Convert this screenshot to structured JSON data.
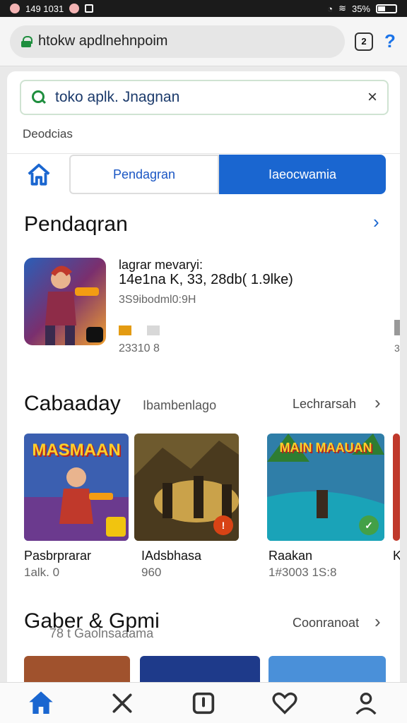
{
  "status_bar": {
    "time": "149 1031",
    "battery": "35%"
  },
  "browser": {
    "url": "htokw apdlnehnpoim",
    "tabs_label": "2",
    "menu_glyph": "?"
  },
  "search": {
    "query": "toko aplk. Jnagnan",
    "clear_glyph": "×"
  },
  "subtitle": "Deodcias",
  "segments": [
    {
      "label": "Pendagran",
      "active": false
    },
    {
      "label": "Iaeocwamia",
      "active": true
    }
  ],
  "section1": {
    "title": "Pendaqran",
    "featured": {
      "line1": "lagrar mevaryi:",
      "line2": "14e1na K, 33, 28db( 1.9lke)",
      "line3": "3S9ibodml0:9H",
      "line4": "23310 8"
    }
  },
  "section2": {
    "title": "Cabaaday",
    "subtitle": "Ibambenlago",
    "more": "Lechrarsah",
    "tiles": [
      {
        "name": "Pasbrprarar",
        "meta": "1alk. 0",
        "art_title": "MASMAAN"
      },
      {
        "name": "IAdsbhasa",
        "meta": "960",
        "art_title": ""
      },
      {
        "name": "Raakan",
        "meta": "1#3003 1S:8",
        "art_title": "MAIN MAAUAN"
      }
    ],
    "peek_letter": "K"
  },
  "section3": {
    "title": "Gaber & Gpmi",
    "subtitle": "78 t Gaolnsaaama",
    "more": "Coonranoat"
  },
  "colors": {
    "accent_blue": "#1a66d0",
    "brand_green": "#1e8e3e"
  },
  "icons": [
    "lock-icon",
    "tabs-icon",
    "menu-icon",
    "search-icon",
    "close-icon",
    "home-icon",
    "chevron-right-icon",
    "x-icon",
    "alert-square-icon",
    "heart-icon",
    "person-icon"
  ]
}
